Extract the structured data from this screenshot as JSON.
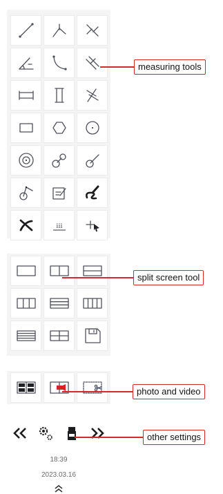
{
  "callouts": {
    "measuring": "measuring tools",
    "split": "split screen tool",
    "media": "photo and video",
    "settings": "other settings"
  },
  "status": {
    "time": "18:39",
    "date": "2023.03.16"
  },
  "measure_tools": {
    "row7_label": "iii"
  },
  "colors": {
    "accent": "#d12a2a",
    "icon": "#4f5159",
    "panel": "#f4f4f4"
  },
  "icons": {
    "measure": [
      "line-icon",
      "polyline-icon",
      "vertical-line-icon",
      "angle-icon",
      "arc-icon",
      "point-to-line-icon",
      "parallel-horizontal-icon",
      "parallel-vertical-icon",
      "line-distance-icon",
      "rectangle-icon",
      "hexagon-icon",
      "circle-icon",
      "concentric-circles-icon",
      "two-circle-distance-icon",
      "circle-to-line-icon",
      "circle-point-icon",
      "edit-text-icon",
      "freehand-draw-icon",
      "delete-icon",
      "count-icon",
      "point-count-icon"
    ],
    "split": [
      "split-single-icon",
      "split-two-vertical-icon",
      "split-two-horizontal-icon",
      "split-three-vertical-icon",
      "split-three-horizontal-icon",
      "split-four-vertical-icon",
      "split-four-horizontal-icon",
      "split-quad-icon",
      "save-icon"
    ],
    "media": [
      "gallery-icon",
      "video-record-icon",
      "screenshot-cut-icon"
    ],
    "settings": [
      "previous-icon",
      "settings-gear-icon",
      "usb-storage-icon",
      "next-icon"
    ]
  }
}
